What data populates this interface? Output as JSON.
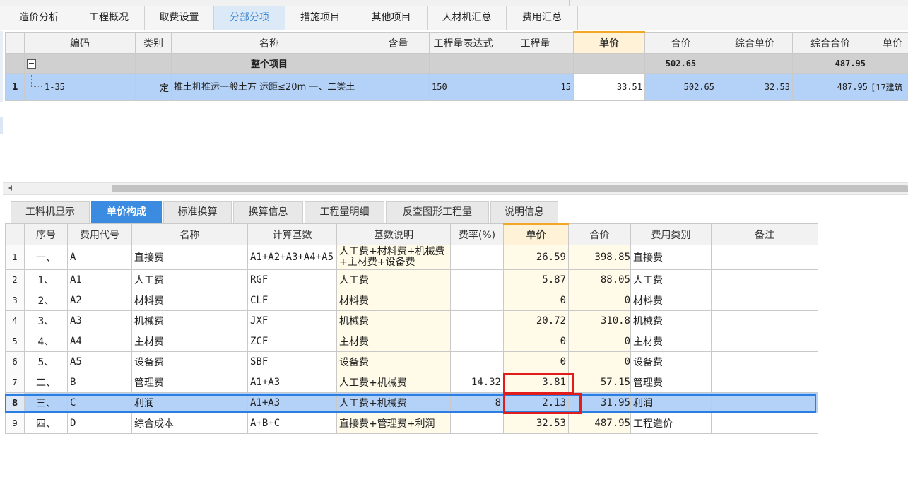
{
  "main_tabs": [
    "造价分析",
    "工程概况",
    "取费设置",
    "分部分项",
    "措施项目",
    "其他项目",
    "人材机汇总",
    "费用汇总"
  ],
  "main_tab_active": "分部分项",
  "upper_table": {
    "headers": [
      "编码",
      "类别",
      "名称",
      "含量",
      "工程量表达式",
      "工程量",
      "单价",
      "合价",
      "综合单价",
      "综合合价",
      "单价"
    ],
    "group_row": {
      "expand_symbol": "−",
      "name": "整个项目",
      "total": "502.65",
      "comp_total": "487.95"
    },
    "item_row": {
      "row_no": "1",
      "code": "1-35",
      "type": "定",
      "name": "推土机推运一般土方 运距≤20m 一、二类土",
      "content": "",
      "expression": "150",
      "quantity": "15",
      "unit_price": "33.51",
      "total": "502.65",
      "comp_unit_price": "32.53",
      "comp_total": "487.95",
      "remark_cut": "[17建筑"
    }
  },
  "sub_tabs": [
    "工料机显示",
    "单价构成",
    "标准换算",
    "换算信息",
    "工程量明细",
    "反查图形工程量",
    "说明信息"
  ],
  "sub_tab_active": "单价构成",
  "lower_table": {
    "headers": [
      "序号",
      "费用代号",
      "名称",
      "计算基数",
      "基数说明",
      "费率(%)",
      "单价",
      "合价",
      "费用类别",
      "备注"
    ],
    "rows": [
      {
        "n": "1",
        "seq": "一、",
        "code": "A",
        "name": "直接费",
        "base": "A1+A2+A3+A4+A5",
        "desc": "人工费+材料费+机械费+主材费+设备费",
        "rate": "",
        "price": "26.59",
        "total": "398.85",
        "category": "直接费",
        "note": ""
      },
      {
        "n": "2",
        "seq": "1、",
        "code": "A1",
        "name": "人工费",
        "base": "RGF",
        "desc": "人工费",
        "rate": "",
        "price": "5.87",
        "total": "88.05",
        "category": "人工费",
        "note": ""
      },
      {
        "n": "3",
        "seq": "2、",
        "code": "A2",
        "name": "材料费",
        "base": "CLF",
        "desc": "材料费",
        "rate": "",
        "price": "0",
        "total": "0",
        "category": "材料费",
        "note": ""
      },
      {
        "n": "4",
        "seq": "3、",
        "code": "A3",
        "name": "机械费",
        "base": "JXF",
        "desc": "机械费",
        "rate": "",
        "price": "20.72",
        "total": "310.8",
        "category": "机械费",
        "note": ""
      },
      {
        "n": "5",
        "seq": "4、",
        "code": "A4",
        "name": "主材费",
        "base": "ZCF",
        "desc": "主材费",
        "rate": "",
        "price": "0",
        "total": "0",
        "category": "主材费",
        "note": ""
      },
      {
        "n": "6",
        "seq": "5、",
        "code": "A5",
        "name": "设备费",
        "base": "SBF",
        "desc": "设备费",
        "rate": "",
        "price": "0",
        "total": "0",
        "category": "设备费",
        "note": ""
      },
      {
        "n": "7",
        "seq": "二、",
        "code": "B",
        "name": "管理费",
        "base": "A1+A3",
        "desc": "人工费+机械费",
        "rate": "14.32",
        "price": "3.81",
        "total": "57.15",
        "category": "管理费",
        "note": ""
      },
      {
        "n": "8",
        "seq": "三、",
        "code": "C",
        "name": "利润",
        "base": "A1+A3",
        "desc": "人工费+机械费",
        "rate": "8",
        "price": "2.13",
        "total": "31.95",
        "category": "利润",
        "note": ""
      },
      {
        "n": "9",
        "seq": "四、",
        "code": "D",
        "name": "综合成本",
        "base": "A+B+C",
        "desc": "直接费+管理费+利润",
        "rate": "",
        "price": "32.53",
        "total": "487.95",
        "category": "工程造价",
        "note": ""
      }
    ]
  },
  "colors": {
    "accent_blue": "#3b8be0",
    "selection": "#b4d2f7",
    "highlight_orange": "#f0a72a",
    "annotation_red": "#e21b1b",
    "cream": "#fffbe8"
  }
}
